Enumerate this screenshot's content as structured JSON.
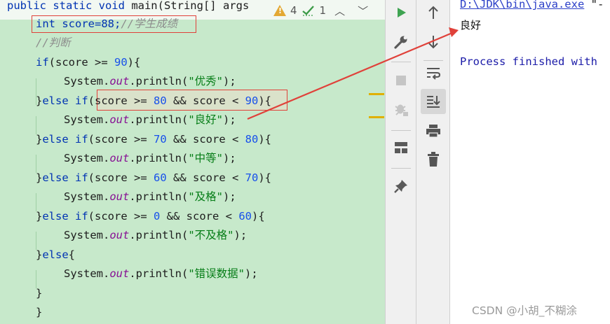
{
  "editor": {
    "lines": {
      "l1_prefix": "public static void ",
      "l1_rest": "main(String[] args",
      "l2_decl": "int score=88;",
      "l2_comment": "//学生成绩",
      "l3_comment": "//判断",
      "l4_if": "if",
      "l4_cond_a": "(score >= ",
      "l4_num": "90",
      "l4_end": "){",
      "l5_sys": "System.",
      "l5_out": "out",
      "l5_println": ".println(",
      "l5_str": "\"优秀\"",
      "l5_end": ");",
      "l6_start": "}",
      "l6_elseif": "else if",
      "l6_a": "(score >= ",
      "l6_n1": "80",
      "l6_b": " && score < ",
      "l6_n2": "90",
      "l6_end": "){",
      "l7_str": "\"良好\"",
      "l8_n1": "70",
      "l8_n2": "80",
      "l9_str": "\"中等\"",
      "l10_n1": "60",
      "l10_n2": "70",
      "l11_str": "\"及格\"",
      "l12_n1": "0",
      "l12_n2": "60",
      "l13_str": "\"不及格\"",
      "l14_else": "else",
      "l14_end": "{",
      "l15_str": "\"错误数据\"",
      "close_brace": "}"
    },
    "inspection": {
      "warnings": "4",
      "weak_warnings": "1"
    }
  },
  "console": {
    "java_path": "D:\\JDK\\bin\\java.exe",
    "java_path_suffix": " \"-",
    "output": "良好",
    "process_finished": "Process finished with"
  },
  "watermark": "CSDN @小胡_不糊涂",
  "colors": {
    "editor_bg": "#c7e9cb",
    "annotation_red": "#e0413a",
    "run_green": "#4caf50"
  }
}
